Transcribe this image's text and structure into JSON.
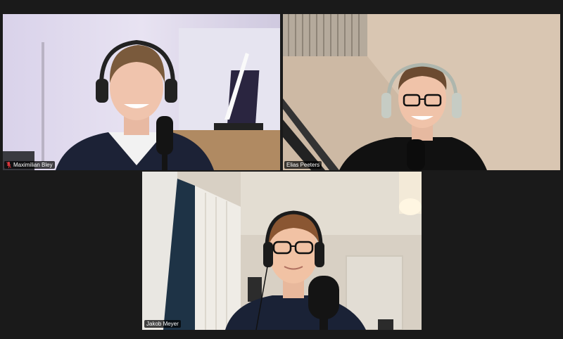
{
  "meeting": {
    "participants": [
      {
        "name": "Maximilian Bley",
        "muted": true,
        "active_speaker": false
      },
      {
        "name": "Elias Peeters",
        "muted": false,
        "active_speaker": false
      },
      {
        "name": "Jakob Meyer",
        "muted": false,
        "active_speaker": true
      }
    ]
  },
  "colors": {
    "background": "#1a1a1a",
    "active_speaker_border": "#d6e36f",
    "muted_indicator": "#e0383e",
    "name_tag_bg": "#000000"
  },
  "icons": {
    "muted": "mic-off-icon"
  }
}
